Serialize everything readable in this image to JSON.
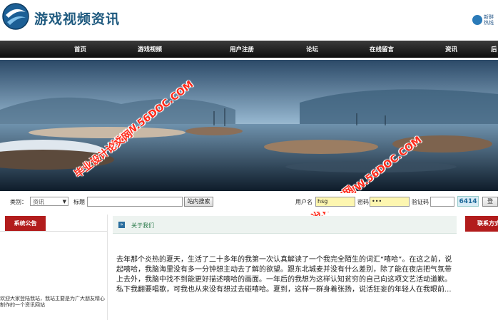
{
  "header": {
    "site_title": "游戏视频资讯",
    "hot_news_label": "新鲜热线"
  },
  "nav": {
    "items": [
      "首页",
      "游戏视频",
      "用户注册",
      "论坛",
      "在线留言",
      "资讯",
      "后"
    ]
  },
  "watermarks": {
    "url": "WWW.56DOC.COM",
    "cn": "毕业设计论文网"
  },
  "searchbar": {
    "category_label": "类别：",
    "category_value": "资讯",
    "title_label": "标题",
    "search_button": "站内搜索",
    "username_label": "用户名",
    "username_value": "hsg",
    "password_label": "密码",
    "password_value": "•••",
    "captcha_label": "验证码",
    "captcha_code": "6414",
    "login_button": "登"
  },
  "left": {
    "tab": "系统公告",
    "text": "欢迎大家登陆我站，我站主要是为广大朋友精心制作的一个资讯网站"
  },
  "main": {
    "tab": "关于我们",
    "icon": "»",
    "body": "去年那个炎热的夏天，生活了二十多年的我第一次认真解读了一个我完全陌生的词汇“嘻哈”。在这之前，说起嘻哈，我脑海里没有多一分钟想主动去了解的欲望。跟东北城麦并没有什么差别，除了能在夜店把气氛带上去外，我脑中找不到能更好描述嘻哈的画面。一年后的我想为这样认知贫穷的自己向这项文艺活动道歉。私下我翻要唱歌，可我也从来没有想过去碰嘻哈。夏到，这样一群身着张扬，说活狂妄的年轻人在我眼前..."
  },
  "right": {
    "tab": "联系方式"
  },
  "colors": {
    "brand": "#1f5a7f",
    "tab_red": "#b21c1c",
    "watermark": "#ff2a1a"
  }
}
